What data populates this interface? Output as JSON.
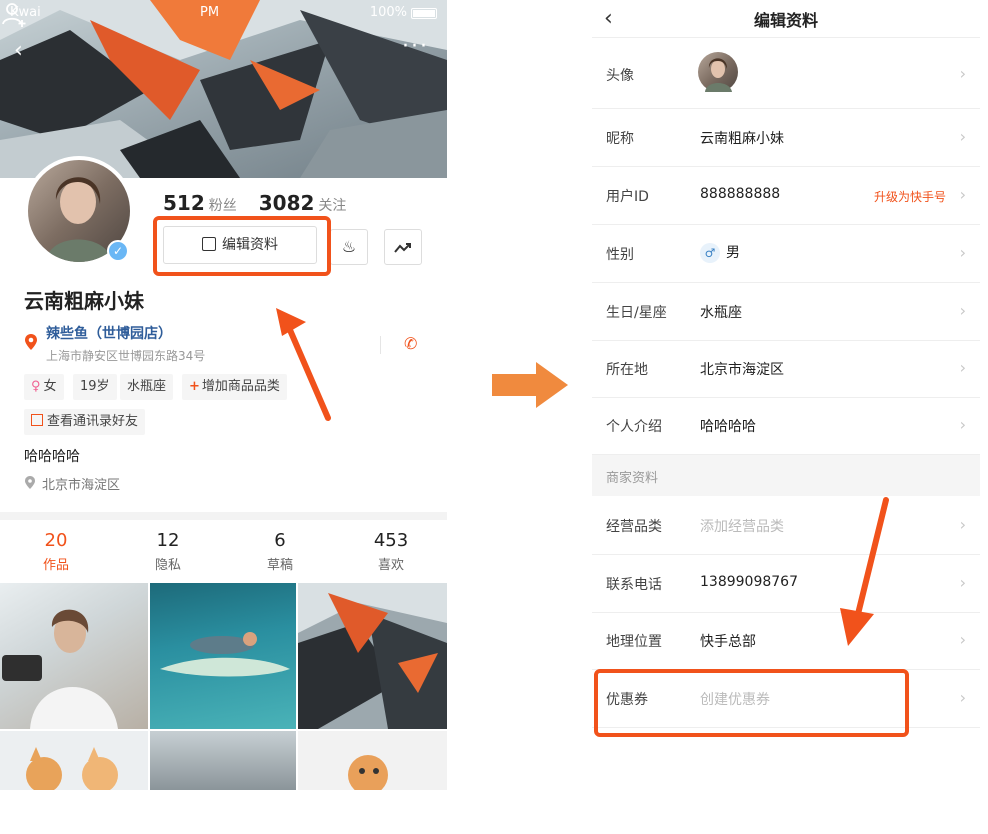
{
  "colors": {
    "accent": "#f1521b",
    "link": "#2f5d9a",
    "muted": "#999999"
  },
  "left": {
    "status": {
      "carrier": "Kwai",
      "time": "PM",
      "battery": "100%"
    },
    "followers": {
      "count": "512",
      "label": "粉丝"
    },
    "following": {
      "count": "3082",
      "label": "关注"
    },
    "edit_label": "编辑资料",
    "name": "云南粗麻小妹",
    "shop": {
      "name": "辣些鱼（世博园店）",
      "address": "上海市静安区世博园东路34号"
    },
    "tags": {
      "gender": "女",
      "age": "19岁",
      "sign": "水瓶座",
      "add_category": "增加商品品类",
      "contacts": "查看通讯录好友"
    },
    "bio": "哈哈哈哈",
    "city": "北京市海淀区",
    "tabs": [
      {
        "count": "20",
        "label": "作品"
      },
      {
        "count": "12",
        "label": "隐私"
      },
      {
        "count": "6",
        "label": "草稿"
      },
      {
        "count": "453",
        "label": "喜欢"
      }
    ]
  },
  "right": {
    "title": "编辑资料",
    "rows": {
      "avatar": {
        "key": "头像"
      },
      "nickname": {
        "key": "昵称",
        "value": "云南粗麻小妹"
      },
      "user_id": {
        "key": "用户ID",
        "value": "888888888",
        "extra": "升级为快手号"
      },
      "gender": {
        "key": "性别",
        "value": "男",
        "symbol": "♂"
      },
      "birthday": {
        "key": "生日/星座",
        "value": "水瓶座"
      },
      "location": {
        "key": "所在地",
        "value": "北京市海淀区"
      },
      "intro": {
        "key": "个人介绍",
        "value": "哈哈哈哈"
      }
    },
    "section_title": "商家资料",
    "merchant_rows": {
      "category": {
        "key": "经营品类",
        "placeholder": "添加经营品类"
      },
      "phone": {
        "key": "联系电话",
        "value": "13899098767"
      },
      "geo": {
        "key": "地理位置",
        "value": "快手总部"
      },
      "coupon": {
        "key": "优惠券",
        "placeholder": "创建优惠券"
      }
    }
  }
}
